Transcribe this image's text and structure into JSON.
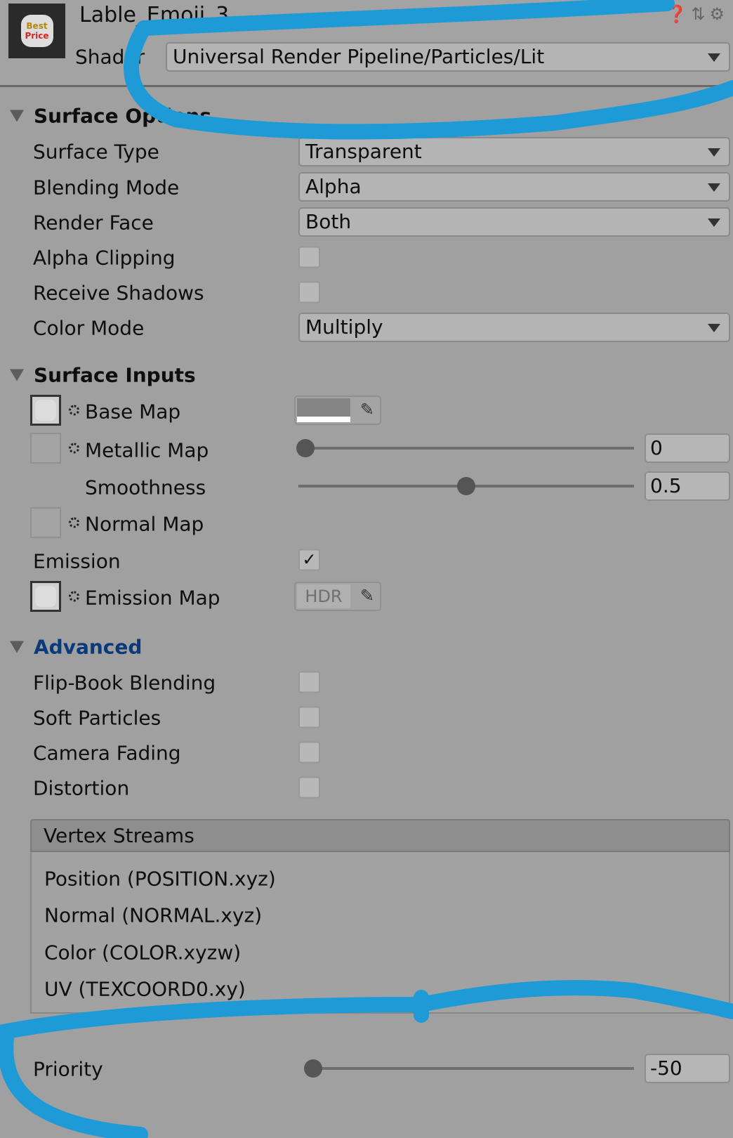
{
  "header": {
    "title": "Lable_Emoji_3",
    "shader_label": "Shader",
    "shader_value": "Universal Render Pipeline/Particles/Lit",
    "thumbnail_text": [
      "Best",
      "Price"
    ],
    "icons": [
      "help-icon",
      "preset-icon",
      "gear-icon"
    ]
  },
  "surface_options": {
    "title": "Surface Options",
    "surface_type": {
      "label": "Surface Type",
      "value": "Transparent"
    },
    "blending_mode": {
      "label": "Blending Mode",
      "value": "Alpha"
    },
    "render_face": {
      "label": "Render Face",
      "value": "Both"
    },
    "alpha_clipping": {
      "label": "Alpha Clipping",
      "checked": false
    },
    "receive_shadows": {
      "label": "Receive Shadows",
      "checked": false
    },
    "color_mode": {
      "label": "Color Mode",
      "value": "Multiply"
    }
  },
  "surface_inputs": {
    "title": "Surface Inputs",
    "base_map": {
      "label": "Base Map",
      "color": "#858585"
    },
    "metallic_map": {
      "label": "Metallic Map",
      "value": "0",
      "fraction": 0
    },
    "smoothness": {
      "label": "Smoothness",
      "value": "0.5",
      "fraction": 0.5
    },
    "normal_map": {
      "label": "Normal Map"
    },
    "emission": {
      "label": "Emission",
      "checked": true,
      "check": "✓"
    },
    "emission_map": {
      "label": "Emission Map",
      "hdr": "HDR"
    }
  },
  "advanced": {
    "title": "Advanced",
    "title_color": "#0b3a7a",
    "flip_book": {
      "label": "Flip-Book Blending",
      "checked": false
    },
    "soft_particles": {
      "label": "Soft Particles",
      "checked": false
    },
    "camera_fading": {
      "label": "Camera Fading",
      "checked": false
    },
    "distortion": {
      "label": "Distortion",
      "checked": false
    }
  },
  "vertex_streams": {
    "title": "Vertex Streams",
    "items": [
      "Position (POSITION.xyz)",
      "Normal (NORMAL.xyz)",
      "Color (COLOR.xyzw)",
      "UV (TEXCOORD0.xy)"
    ]
  },
  "priority": {
    "label": "Priority",
    "value": "-50",
    "fraction": 0
  },
  "annotation_color": "#1e9ad6"
}
